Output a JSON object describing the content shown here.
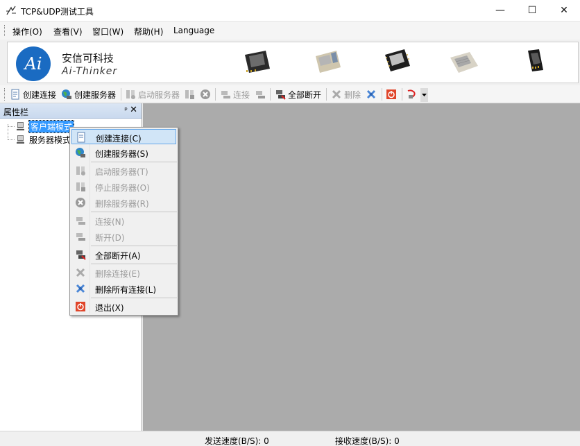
{
  "window": {
    "title": "TCP&UDP测试工具",
    "minimize_glyph": "—",
    "maximize_glyph": "☐",
    "close_glyph": "✕"
  },
  "menubar": {
    "items": [
      {
        "label": "操作(O)"
      },
      {
        "label": "查看(V)"
      },
      {
        "label": "窗口(W)"
      },
      {
        "label": "帮助(H)"
      },
      {
        "label": "Language"
      }
    ]
  },
  "banner": {
    "logo_text": "Ai",
    "brand_cn": "安信可科技",
    "brand_en": "Ai-Thinker"
  },
  "toolbar": {
    "create_connection": "创建连接",
    "create_server": "创建服务器",
    "start_server": "启动服务器",
    "connect": "连接",
    "disconnect_all": "全部断开",
    "delete": "删除"
  },
  "panel": {
    "title": "属性栏",
    "pin_glyph": "ᵖ",
    "close_glyph": "✕",
    "tree": [
      {
        "label": "客户端模式",
        "selected": true
      },
      {
        "label": "服务器模式",
        "selected": false
      }
    ]
  },
  "context_menu": {
    "items": [
      {
        "label": "创建连接(C)",
        "enabled": true,
        "highlighted": true
      },
      {
        "label": "创建服务器(S)",
        "enabled": true
      },
      {
        "label": "启动服务器(T)",
        "enabled": false
      },
      {
        "label": "停止服务器(O)",
        "enabled": false
      },
      {
        "label": "删除服务器(R)",
        "enabled": false
      },
      {
        "label": "连接(N)",
        "enabled": false
      },
      {
        "label": "断开(D)",
        "enabled": false
      },
      {
        "label": "全部断开(A)",
        "enabled": true
      },
      {
        "label": "删除连接(E)",
        "enabled": false
      },
      {
        "label": "删除所有连接(L)",
        "enabled": true
      },
      {
        "label": "退出(X)",
        "enabled": true
      }
    ]
  },
  "statusbar": {
    "send_speed": "发送速度(B/S): 0",
    "recv_speed": "接收速度(B/S): 0"
  },
  "colors": {
    "selection": "#3399ff",
    "workspace": "#ababab",
    "logo_blue": "#1a6bc2",
    "menu_highlight": "#d1e5f7"
  }
}
